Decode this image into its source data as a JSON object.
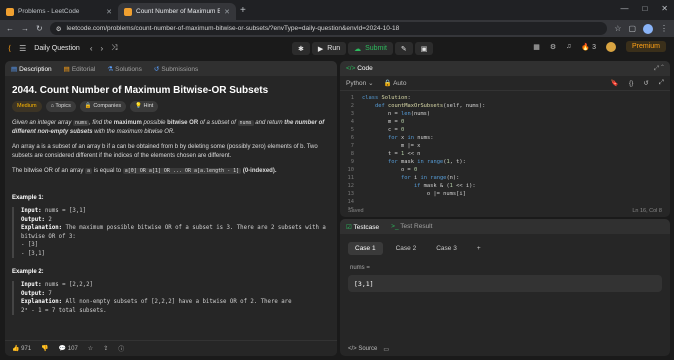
{
  "browser": {
    "tabs": [
      {
        "label": "Problems - LeetCode",
        "active": false
      },
      {
        "label": "Count Number of Maximum Bit",
        "active": true
      }
    ],
    "url": "leetcode.com/problems/count-number-of-maximum-bitwise-or-subsets/?envType=daily-question&envId=2024-10-18",
    "avatar_letter": "G"
  },
  "lcnav": {
    "section": "Daily Question",
    "run_label": "Run",
    "submit_label": "Submit",
    "streak": "3",
    "premium_label": "Premium"
  },
  "left": {
    "tabs": [
      "Description",
      "Editorial",
      "Solutions",
      "Submissions"
    ],
    "title": "2044. Count Number of Maximum Bitwise-OR Subsets",
    "chips": [
      "Medium",
      "Topics",
      "Companies",
      "Hint"
    ],
    "p1_a": "Given an integer array",
    "p1_code": "nums",
    "p1_b": ", find the",
    "p1_c": "maximum",
    "p1_d": "possible",
    "p1_e": "bitwise OR",
    "p1_f": "of a subset of",
    "p1_g": "and return",
    "p1_h": "the number of different non-empty subsets",
    "p1_i": "with the maximum bitwise OR.",
    "p2": "An array a is a subset of an array b if a can be obtained from b by deleting some (possibly zero) elements of b. Two subsets are considered different if the indices of the elements chosen are different.",
    "p3_a": "The bitwise OR of an array",
    "p3_code1": "a",
    "p3_b": "is equal to",
    "p3_code2": "a[0] OR a[1] OR ... OR a[a.length - 1]",
    "p3_c": "(0-indexed).",
    "ex1_title": "Example 1:",
    "ex1_input": "nums = [3,1]",
    "ex1_output": "2",
    "ex1_expl": "The maximum possible bitwise OR of a subset is 3. There are 2 subsets with a bitwise OR of 3:",
    "ex1_items": [
      "- [3]",
      "- [3,1]"
    ],
    "ex2_title": "Example 2:",
    "ex2_input": "nums = [2,2,2]",
    "ex2_output": "7",
    "ex2_expl": "All non-empty subsets of [2,2,2] have a bitwise OR of 2. There are",
    "ex2_expl2": "2³ - 1 = 7 total subsets.",
    "input_label": "Input:",
    "output_label": "Output:",
    "expl_label": "Explanation:",
    "likes": "971",
    "comments": "107"
  },
  "code": {
    "title": "Code",
    "language": "Python",
    "auto": "Auto",
    "saved": "Saved",
    "cursor": "Ln 16, Col 8",
    "lines": [
      "class Solution:",
      "    def countMaxOrSubsets(self, nums):",
      "        n = len(nums)",
      "        m = 0",
      "        c = 0",
      "        for x in nums:",
      "            m |= x",
      "        t = 1 << n",
      "        for mask in range(1, t):",
      "            o = 0",
      "            for i in range(n):",
      "                if mask & (1 << i):",
      "                    o |= nums[i]",
      "",
      ""
    ]
  },
  "test": {
    "tabs": [
      "Testcase",
      "Test Result"
    ],
    "cases": [
      "Case 1",
      "Case 2",
      "Case 3"
    ],
    "input_label": "nums =",
    "input_value": "[3,1]",
    "source": "Source"
  }
}
